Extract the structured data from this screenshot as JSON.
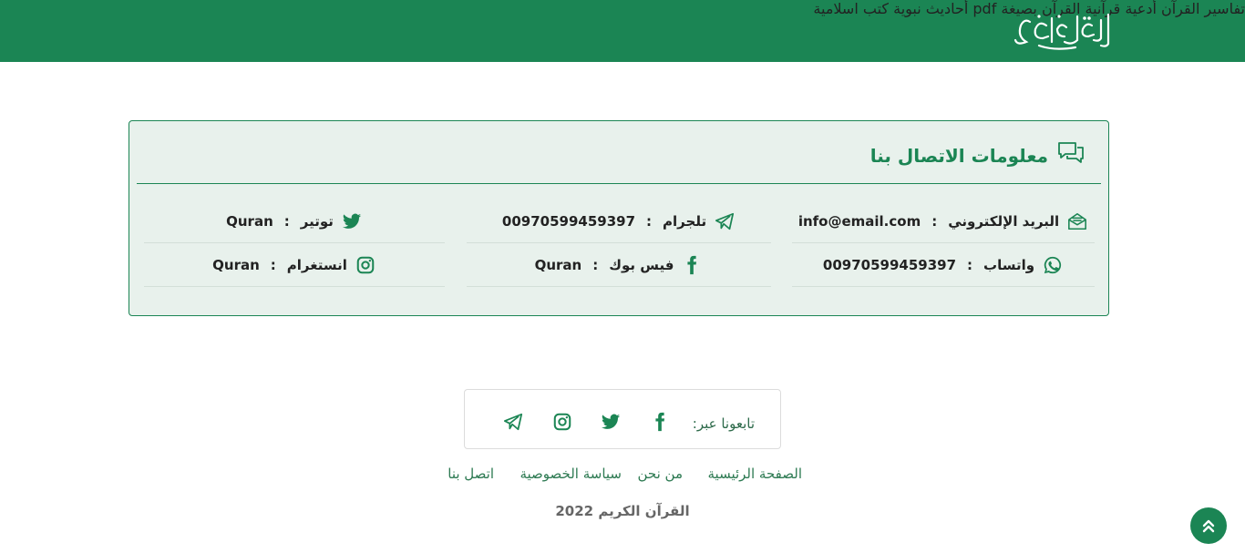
{
  "header": {
    "logo_text": "القرآن الكريم",
    "nav": [
      {
        "label": "تفاسير القرآن"
      },
      {
        "label": "أدعية قرآنية"
      },
      {
        "label": "القرآن بصيغة pdf"
      },
      {
        "label": "أحاديث نبوية"
      },
      {
        "label": "كتب اسلامية"
      }
    ]
  },
  "contact": {
    "title": "معلومات الاتصال بنا",
    "items": {
      "email": {
        "label": "البريد الإلكتروني",
        "value": "info@email.com",
        "icon": "envelope-open-icon"
      },
      "whatsapp": {
        "label": "واتساب",
        "value": "00970599459397",
        "icon": "whatsapp-icon"
      },
      "telegram": {
        "label": "تلجرام",
        "value": "00970599459397",
        "icon": "telegram-icon"
      },
      "facebook": {
        "label": "فيس بوك",
        "value": "Quran",
        "icon": "facebook-icon"
      },
      "twitter": {
        "label": "توتير",
        "value": "Quran",
        "icon": "twitter-icon"
      },
      "instagram": {
        "label": "انستغرام",
        "value": "Quran",
        "icon": "instagram-icon"
      }
    },
    "separator": ":"
  },
  "follow": {
    "label": "تابعونا عبر:",
    "icons": [
      "facebook-icon",
      "twitter-icon",
      "instagram-icon",
      "telegram-icon"
    ]
  },
  "footer": {
    "links": [
      "الصفحة الرئيسية",
      "من نحن",
      "سياسة الخصوصية",
      "اتصل بنا"
    ],
    "copyright": "القرآن الكريم 2022"
  },
  "colors": {
    "brand": "#1b8554",
    "card_bg": "#e8f1ec",
    "link": "#2d7a52"
  }
}
